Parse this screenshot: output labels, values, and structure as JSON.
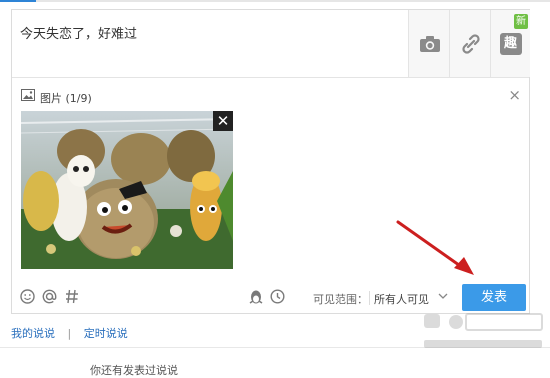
{
  "status": {
    "text": "今天失恋了，好难过"
  },
  "toolbar": {
    "camera_icon": "camera-icon",
    "link_icon": "link-icon",
    "fun_icon": "fun-icon",
    "fun_glyph": "趣",
    "new_badge": "新"
  },
  "image_panel": {
    "label": "图片 (1/9)",
    "close_glyph": "×",
    "thumb_close_glyph": "✕"
  },
  "bottom": {
    "visibility_label": "可见范围：",
    "visibility_value": "所有人可见",
    "publish_label": "发表"
  },
  "tabs": [
    {
      "label": "我的说说"
    },
    {
      "label": "定时说说"
    }
  ],
  "tab_separator": "|",
  "footer": {
    "partial_text": "你还有发表过说说"
  },
  "colors": {
    "accent": "#3b9ae8",
    "link": "#2a6fbd",
    "arrow": "#cc1f1f",
    "badge": "#6fbf44"
  }
}
